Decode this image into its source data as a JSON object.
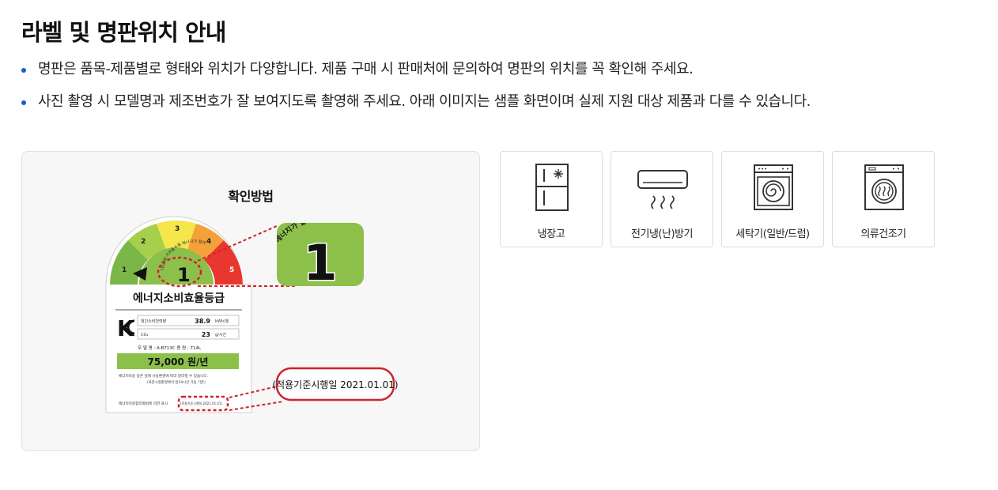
{
  "page": {
    "title": "라벨 및 명판위치 안내",
    "notes": [
      "명판은 품목-제품별로 형태와 위치가 다양합니다. 제품 구매 시 판매처에 문의하여 명판의 위치를 꼭 확인해 주세요.",
      "사진 촬영 시 모델명과 제조번호가 잘 보여지도록 촬영해 주세요. 아래 이미지는 샘플 화면이며 실제 지원 대상 제품과 다를 수 있습니다."
    ]
  },
  "guide": {
    "title": "확인방법",
    "label": {
      "grade_numbers": [
        "1",
        "2",
        "3",
        "4",
        "5"
      ],
      "grade": "1",
      "zoom_grade": "1",
      "zoom_arc_text": "에 가까울수록 에너지가 절약",
      "gauge_arc_text": "1등급에 가까울수록 에너지가 절약",
      "heading": "에너지소비효율등급",
      "kc": "K",
      "rows": [
        {
          "label": "월간소비전력량",
          "value": "38.9",
          "unit": "kWh/월"
        },
        {
          "label": "CO₂",
          "value": "23",
          "unit": "g/시간"
        }
      ],
      "model_line": "모 델 명 : A-B713C    용  량 : 714L",
      "cost": "75,000 원/년",
      "small_1": "에너지비용 등은 실제 사용환경에 따라 달라질 수 있습니다.",
      "small_2": "(표준시험환경에서 일24시간 가동 기준)",
      "footer": "에너지이용합리화법에 의한 표시",
      "footer_date": "(적용기준시행일 2021.01.01)",
      "callout": "(적용기준시행일 2021.01.01)"
    },
    "colors": {
      "green_dark": "#7ab648",
      "green_light": "#a6cf4b",
      "yellow": "#f4e64b",
      "orange": "#f4a13a",
      "red": "#e8372f",
      "callout_red": "#d0232c"
    }
  },
  "categories": [
    {
      "label": "냉장고",
      "icon": "refrigerator-icon"
    },
    {
      "label": "전기냉(난)방기",
      "icon": "air-conditioner-icon"
    },
    {
      "label": "세탁기(일반/드럼)",
      "icon": "washing-machine-icon"
    },
    {
      "label": "의류건조기",
      "icon": "clothes-dryer-icon"
    }
  ]
}
